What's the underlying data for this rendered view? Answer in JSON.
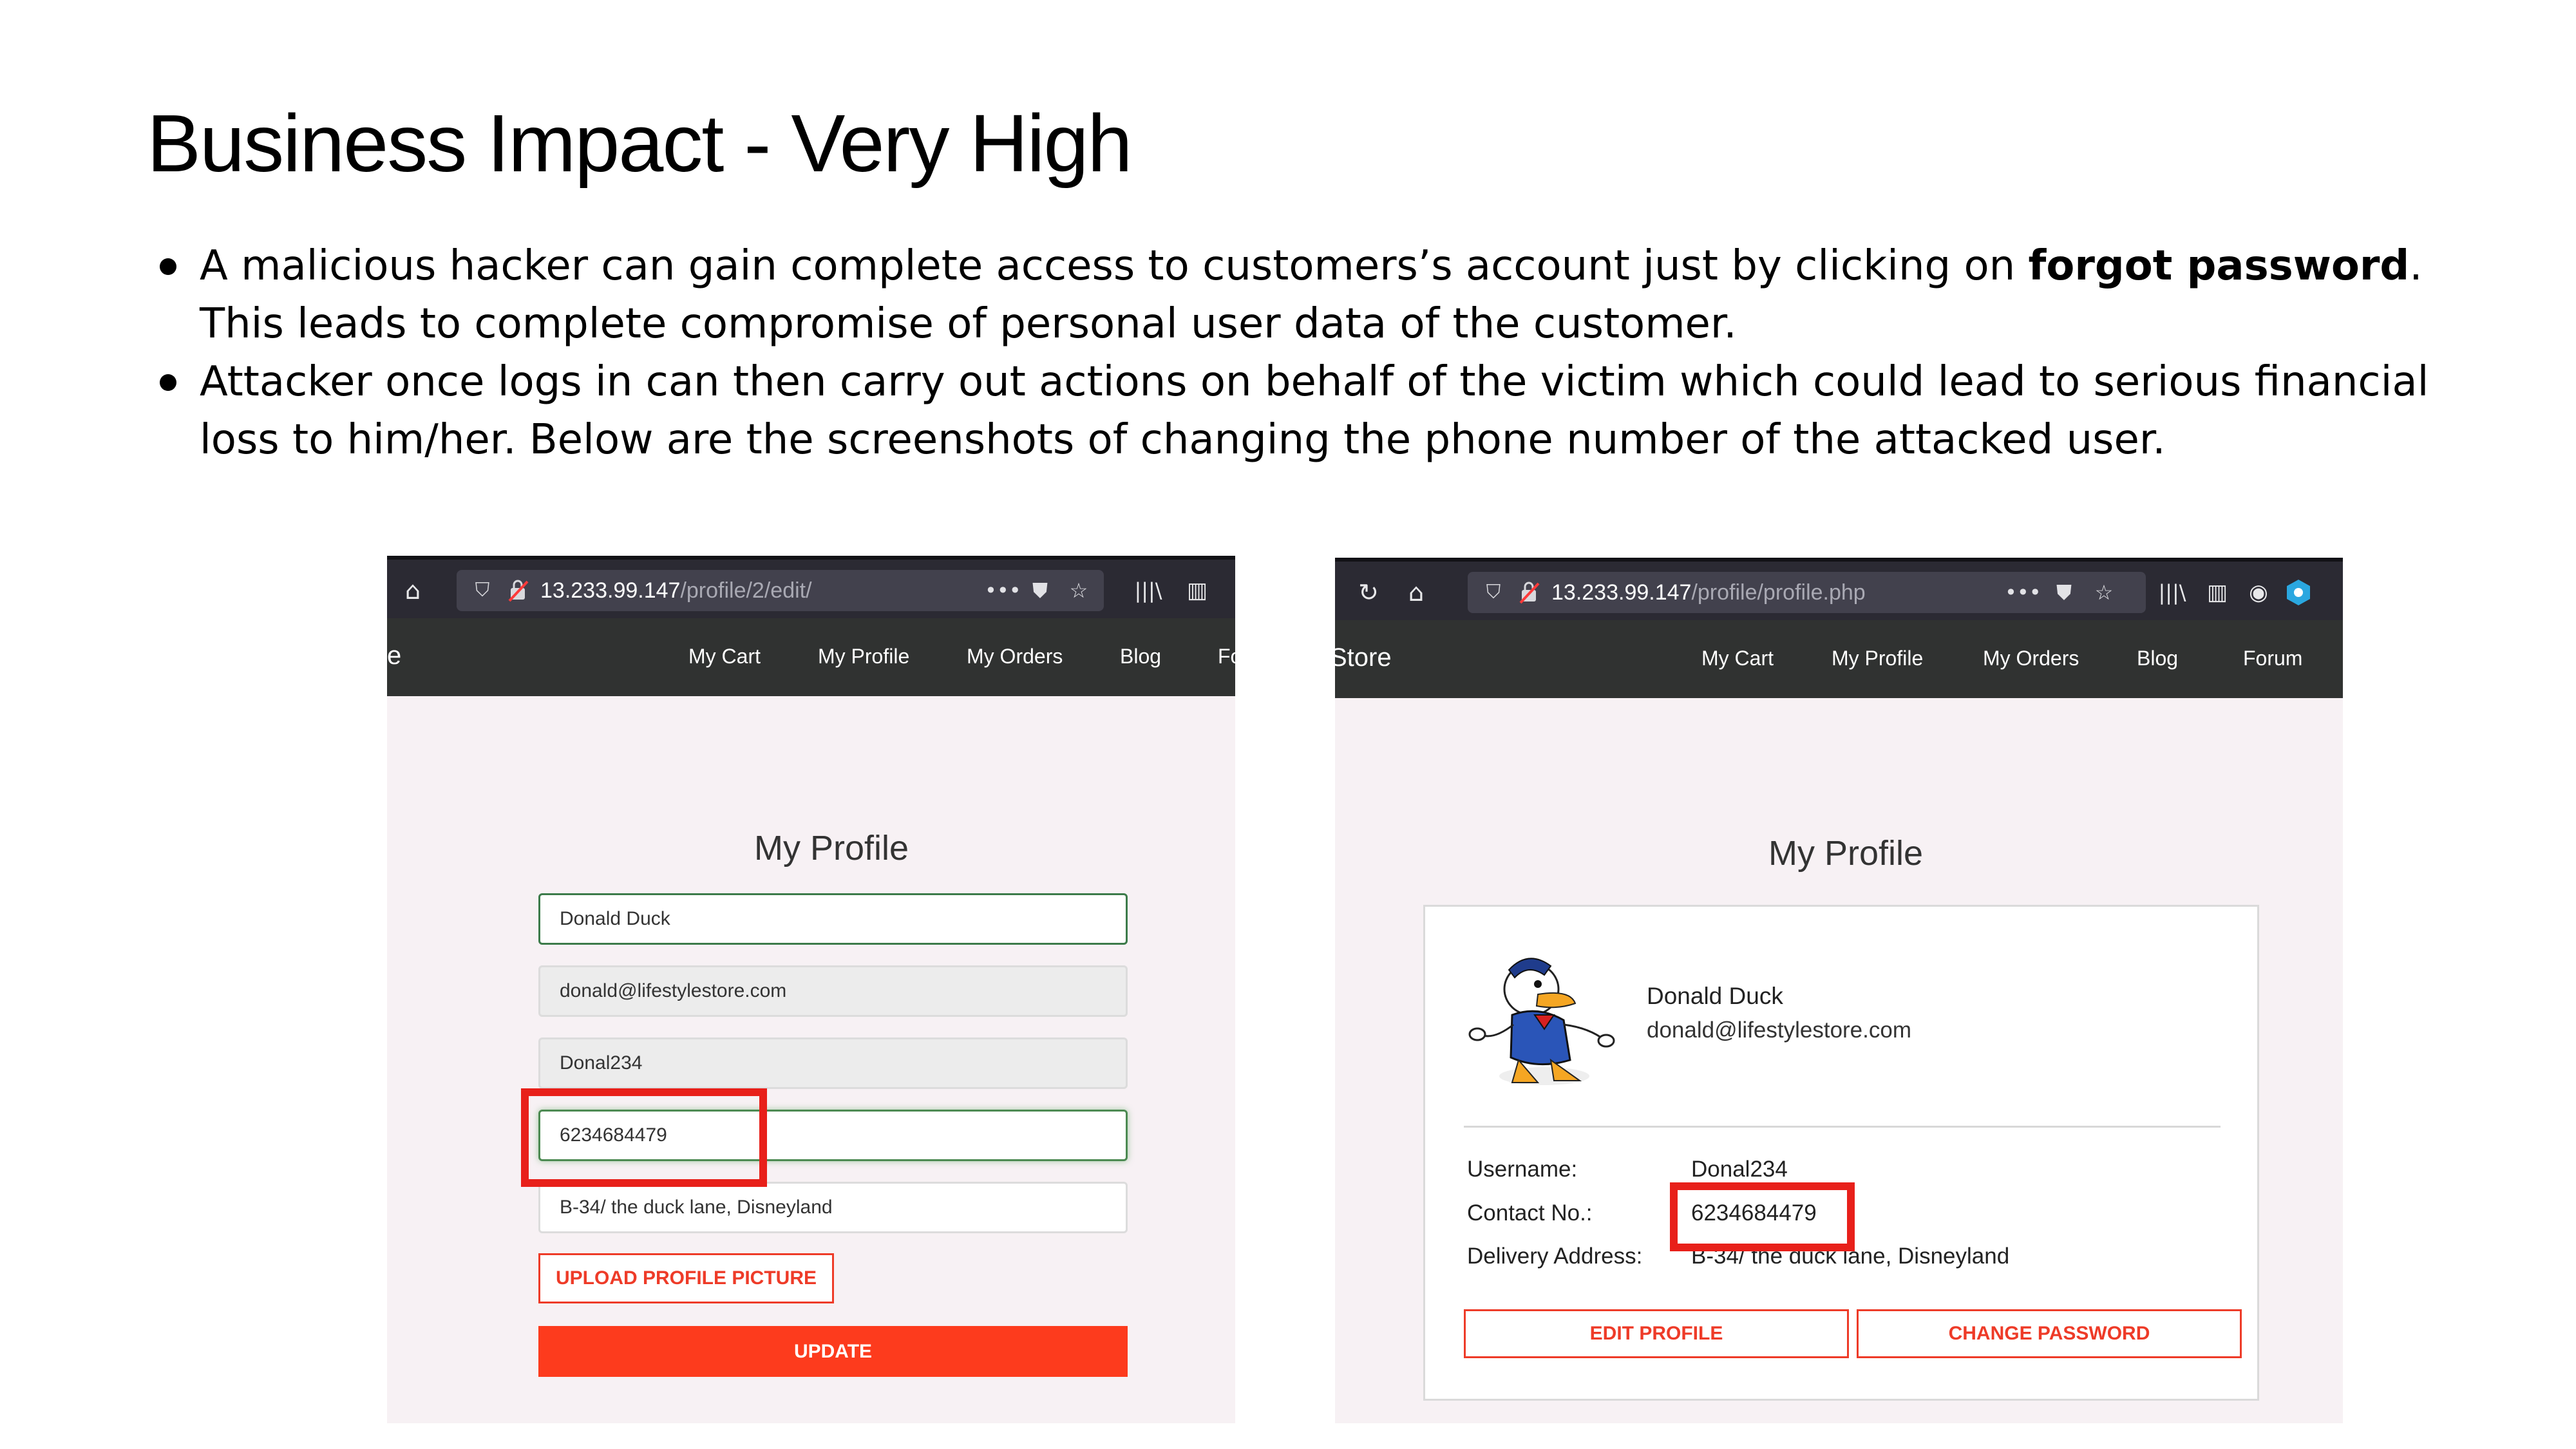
{
  "slide": {
    "title": "Business Impact - Very High",
    "bullets": [
      {
        "before": "A malicious hacker can gain complete access to customers’s account just by clicking on ",
        "bold": "forgot password",
        "after": ". This leads to complete compromise of personal user data of the customer."
      },
      {
        "text": "Attacker once logs in can then carry out actions on behalf of the victim which could lead to serious financial loss to him/her. Below are the screenshots of changing the phone number of the attacked user."
      }
    ]
  },
  "left_screenshot": {
    "url_host": "13.233.99.147",
    "url_path": "/profile/2/edit/",
    "brand_partial": "e",
    "nav": [
      "My Cart",
      "My Profile",
      "My Orders",
      "Blog",
      "Fo"
    ],
    "heading": "My Profile",
    "fields": {
      "name": "Donald Duck",
      "email": "donald@lifestylestore.com",
      "username": "Donal234",
      "phone": "6234684479",
      "address": "B-34/ the duck lane, Disneyland"
    },
    "upload_label": "UPLOAD PROFILE PICTURE",
    "update_label": "UPDATE"
  },
  "right_screenshot": {
    "url_host": "13.233.99.147",
    "url_path": "/profile/profile.php",
    "brand_partial": "Store",
    "nav": [
      "My Cart",
      "My Profile",
      "My Orders",
      "Blog",
      "Forum"
    ],
    "heading": "My Profile",
    "card": {
      "name": "Donald Duck",
      "email": "donald@lifestylestore.com",
      "username_label": "Username:",
      "username_value": "Donal234",
      "contact_label": "Contact No.:",
      "contact_value": "6234684479",
      "address_label": "Delivery Address:",
      "address_value": "B-34/ the duck lane, Disneyland",
      "edit_label": "EDIT PROFILE",
      "change_password_label": "CHANGE PASSWORD"
    }
  },
  "colors": {
    "highlight": "#e8201a",
    "accent": "#fd3b1d",
    "navbar": "#303231",
    "browser_chrome": "#2b2a33"
  },
  "icons": [
    "home-icon",
    "reload-icon",
    "shield-icon",
    "lock-warning-icon",
    "more-icon",
    "pocket-icon",
    "star-icon",
    "library-icon",
    "sidebar-icon",
    "account-icon",
    "extension-icon"
  ]
}
